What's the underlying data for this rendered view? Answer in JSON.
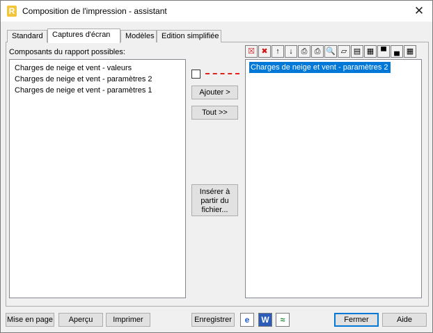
{
  "window": {
    "title": "Composition de l'impression - assistant",
    "app_icon": "R"
  },
  "tabs": [
    {
      "label": "Standard"
    },
    {
      "label": "Captures d'écran"
    },
    {
      "label": "Modèles"
    },
    {
      "label": "Edition simplifiée"
    }
  ],
  "active_tab": "Captures d'écran",
  "left_panel": {
    "label": "Composants du rapport possibles:",
    "items": [
      "Charges de neige et vent - valeurs",
      "Charges de neige et vent - paramètres 2",
      "Charges de neige et vent - paramètres 1"
    ]
  },
  "right_panel": {
    "items": [
      "Charges de neige et vent - paramètres 2"
    ],
    "selected_index": 0
  },
  "middle": {
    "add_label": "Ajouter >",
    "all_label": "Tout >>",
    "insert_label_line1": "Insérer à",
    "insert_label_line2": "partir du",
    "insert_label_line3": "fichier..."
  },
  "toolbar_icons": [
    "delete-icon",
    "delete-all-icon",
    "move-up-icon",
    "move-down-icon",
    "print-selected-icon",
    "print-options-icon",
    "page-preview-icon",
    "open-icon",
    "printer-icon",
    "properties-icon",
    "header-icon",
    "footer-icon",
    "table-icon"
  ],
  "bottom": {
    "page_setup": "Mise en page",
    "preview": "Aperçu",
    "print": "Imprimer",
    "save": "Enregistrer",
    "close": "Fermer",
    "help": "Aide",
    "icon_ie": "e",
    "icon_word": "W",
    "icon_chart": "≈"
  },
  "colors": {
    "selection": "#0078d7",
    "dashed_line": "#e0201a",
    "icon_accent": "#f3c53a"
  }
}
